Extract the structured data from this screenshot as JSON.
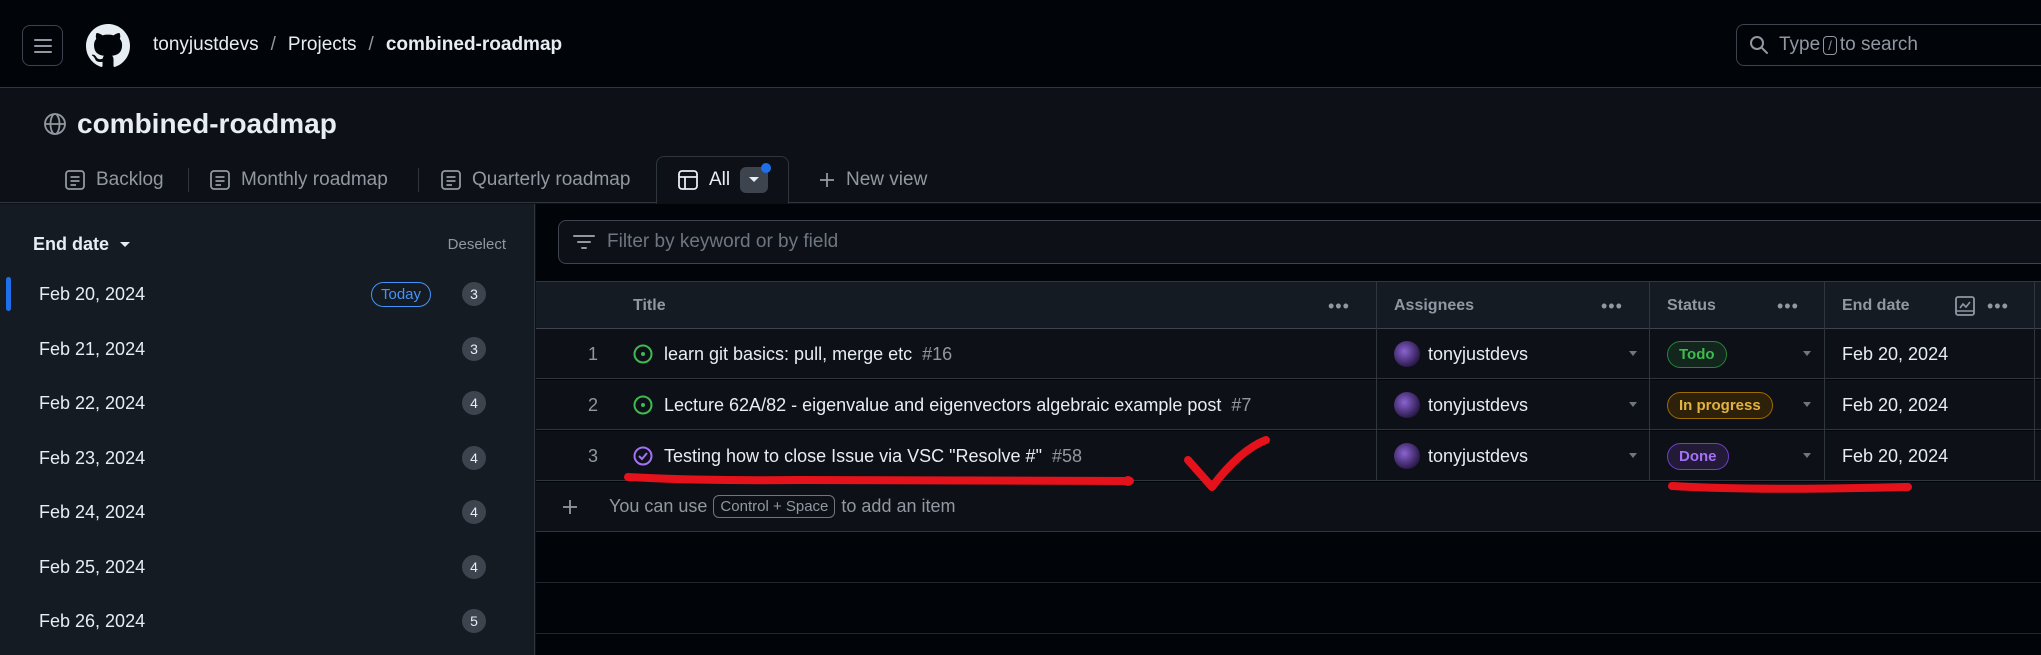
{
  "header": {
    "breadcrumbs": [
      "tonyjustdevs",
      "Projects",
      "combined-roadmap"
    ],
    "search_prefix": "Type",
    "search_key": "/",
    "search_suffix": "to search"
  },
  "project": {
    "title": "combined-roadmap"
  },
  "tabs": [
    {
      "label": "Backlog"
    },
    {
      "label": "Monthly roadmap"
    },
    {
      "label": "Quarterly roadmap"
    },
    {
      "label": "All"
    },
    {
      "label": "New view"
    }
  ],
  "sidebar": {
    "title": "End date",
    "deselect": "Deselect",
    "today_badge": "Today",
    "items": [
      {
        "label": "Feb 20, 2024",
        "count": "3"
      },
      {
        "label": "Feb 21, 2024",
        "count": "3"
      },
      {
        "label": "Feb 22, 2024",
        "count": "4"
      },
      {
        "label": "Feb 23, 2024",
        "count": "4"
      },
      {
        "label": "Feb 24, 2024",
        "count": "4"
      },
      {
        "label": "Feb 25, 2024",
        "count": "4"
      },
      {
        "label": "Feb 26, 2024",
        "count": "5"
      }
    ]
  },
  "filter": {
    "placeholder": "Filter by keyword or by field"
  },
  "table": {
    "columns": [
      "Title",
      "Assignees",
      "Status",
      "End date"
    ],
    "rows": [
      {
        "num": "1",
        "title": "learn git basics: pull, merge etc",
        "issue": "#16",
        "assignee": "tonyjustdevs",
        "status": "Todo",
        "end_date": "Feb 20, 2024"
      },
      {
        "num": "2",
        "title": "Lecture 62A/82 - eigenvalue and eigenvectors algebraic example post",
        "issue": "#7",
        "assignee": "tonyjustdevs",
        "status": "In progress",
        "end_date": "Feb 20, 2024"
      },
      {
        "num": "3",
        "title": "Testing how to close Issue via VSC \"Resolve #\"",
        "issue": "#58",
        "assignee": "tonyjustdevs",
        "status": "Done",
        "end_date": "Feb 20, 2024"
      }
    ],
    "add_prefix": "You can use",
    "add_key": "Control + Space",
    "add_suffix": "to add an item"
  },
  "colors": {
    "accent": "#1f6feb",
    "todo": "#3fb950",
    "in_progress": "#e3b341",
    "done": "#a371f7",
    "annotation": "#e5121b"
  }
}
